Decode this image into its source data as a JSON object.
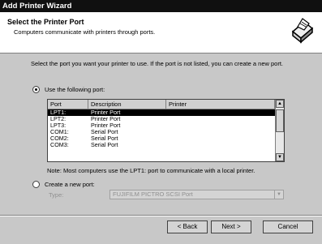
{
  "window": {
    "title": "Add Printer Wizard"
  },
  "header": {
    "title": "Select the Printer Port",
    "subtitle": "Computers communicate with printers through ports."
  },
  "intro": "Select the port you want your printer to use.  If the port is not listed, you can create a new port.",
  "use_port": {
    "label": "Use the following port:",
    "checked": true
  },
  "ports": {
    "columns": [
      "Port",
      "Description",
      "Printer"
    ],
    "rows": [
      {
        "port": "LPT1:",
        "description": "Printer Port",
        "printer": "",
        "selected": true
      },
      {
        "port": "LPT2:",
        "description": "Printer Port",
        "printer": ""
      },
      {
        "port": "LPT3:",
        "description": "Printer Port",
        "printer": ""
      },
      {
        "port": "COM1:",
        "description": "Serial Port",
        "printer": ""
      },
      {
        "port": "COM2:",
        "description": "Serial Port",
        "printer": ""
      },
      {
        "port": "COM3:",
        "description": "Serial Port",
        "printer": ""
      }
    ]
  },
  "note": "Note: Most computers use the LPT1: port to communicate with a local printer.",
  "create_port": {
    "label": "Create a new port:",
    "checked": false,
    "type_label": "Type:",
    "type_value": "FUJIFILM PICTRO SCSI Port"
  },
  "buttons": {
    "back": "< Back",
    "next": "Next >",
    "cancel": "Cancel"
  },
  "icons": {
    "header": "printer-icon"
  }
}
